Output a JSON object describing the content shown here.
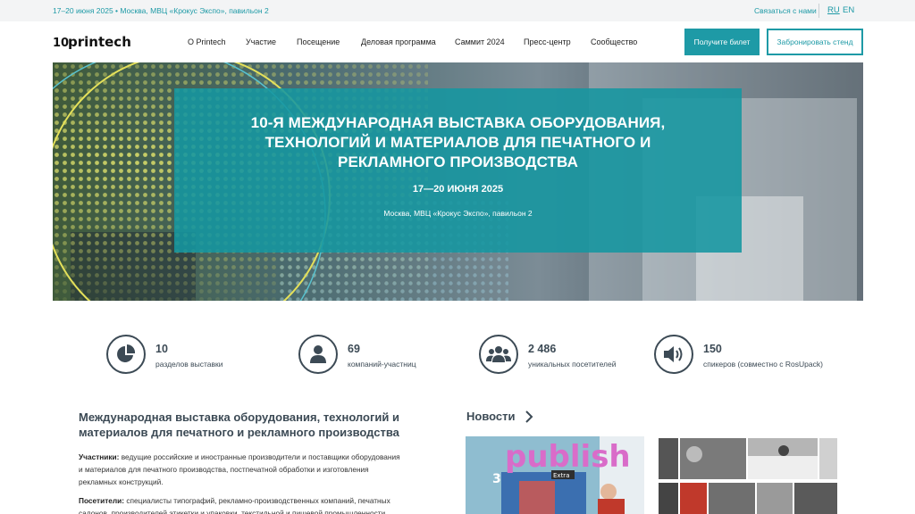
{
  "topbar": {
    "info": "17–20 июня 2025 • Москва, МВЦ «Крокус Экспо», павильон 2",
    "contact": "Связаться с нами",
    "lang_ru": "RU",
    "lang_en": "EN"
  },
  "header": {
    "logo_text": "printech",
    "logo_number": "10",
    "nav": [
      "О Printech",
      "Участие",
      "Посещение",
      "Деловая программа",
      "Саммит 2024",
      "Пресс-центр",
      "Сообщество"
    ],
    "ticket_button": "Получите билет",
    "stand_button": "Забронировать стенд"
  },
  "hero": {
    "title_line1": "10-Я МЕЖДУНАРОДНАЯ ВЫСТАВКА ОБОРУДОВАНИЯ,",
    "title_line2": "ТЕХНОЛОГИЙ И МАТЕРИАЛОВ ДЛЯ ПЕЧАТНОГО И",
    "title_line3": "РЕКЛАМНОГО ПРОИЗВОДСТВА",
    "dates": "17—20 ИЮНЯ 2025",
    "place": "Москва, МВЦ «Крокус Экспо», павильон 2"
  },
  "stats": [
    {
      "value": "10",
      "label": "разделов выставки",
      "icon": "pie-chart-icon"
    },
    {
      "value": "69",
      "label": "компаний-участниц",
      "icon": "person-icon"
    },
    {
      "value": "2 486",
      "label": "уникальных посетителей",
      "icon": "group-icon"
    },
    {
      "value": "150",
      "label": "спикеров (совместно с RosUpack)",
      "icon": "speaker-icon"
    }
  ],
  "about": {
    "title_line1": "Международная выставка оборудования, технологий и",
    "title_line2": "материалов для печатного и рекламного производства",
    "participants_label": "Участники:",
    "participants_line1": " ведущие российские и иностранные производители и поставщики оборудования",
    "participants_line2": "и материалов для печатного производства, постпечатной обработки и изготовления",
    "participants_line3": "рекламных конструкций.",
    "visitors_label": "Посетители:",
    "visitors_line1": " специалисты типографий, рекламно-производственных компаний, печатных",
    "visitors_line2": "салонов, производителей этикетки и упаковки, текстильной и пищевой промышленности"
  },
  "news": {
    "title": "Новости",
    "item1_image_text": "publish",
    "item1_badge": "Extra",
    "item1_number": "3"
  },
  "colors": {
    "accent": "#1e9aa6",
    "dark": "#3c4a55",
    "topbar_bg": "#f3f4f5"
  }
}
